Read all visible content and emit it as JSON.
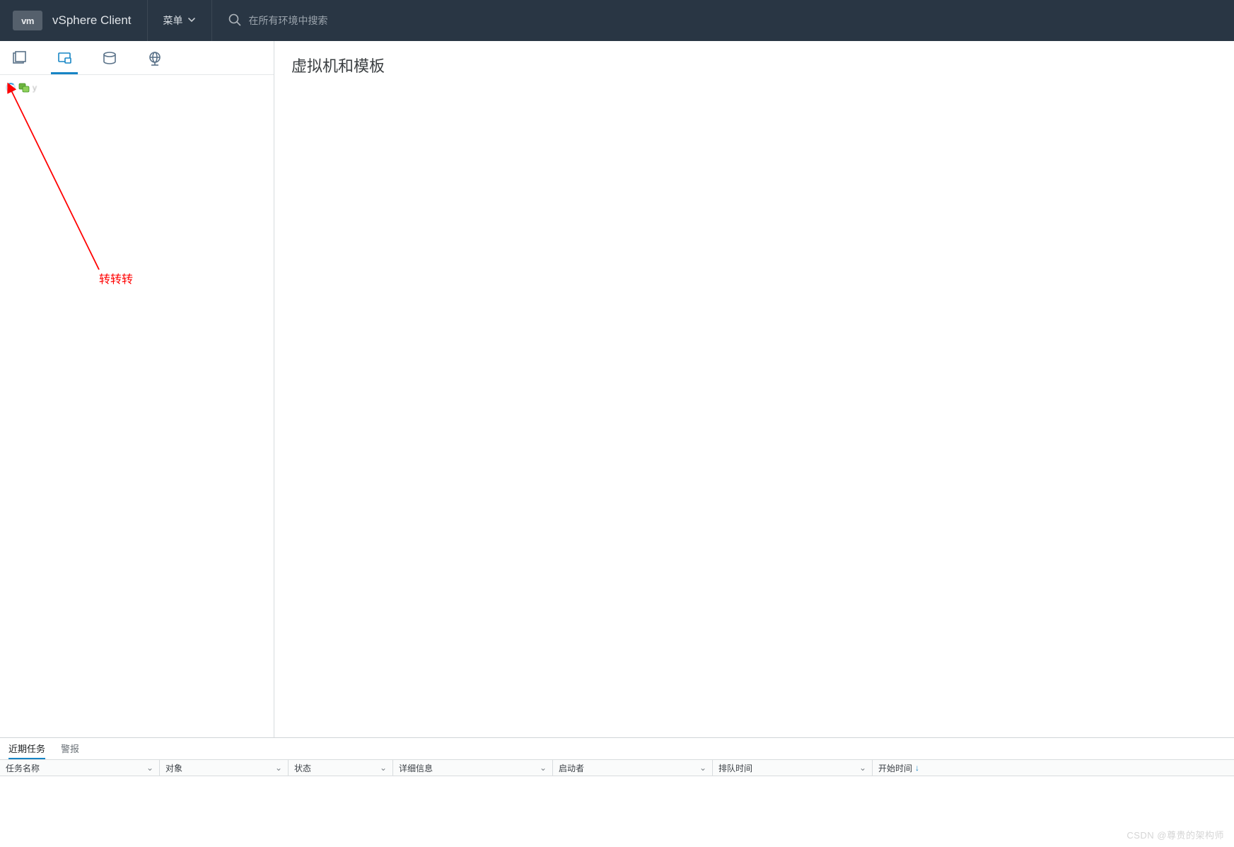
{
  "header": {
    "logo_text": "vm",
    "app_title": "vSphere Client",
    "menu_label": "菜单",
    "search_placeholder": "在所有环境中搜索"
  },
  "sidebar": {
    "tree_item_label": "y",
    "annotation_text": "转转转"
  },
  "main": {
    "title": "虚拟机和模板"
  },
  "bottom": {
    "tabs": {
      "recent": "近期任务",
      "alarms": "警报"
    },
    "columns": {
      "task_name": "任务名称",
      "target": "对象",
      "status": "状态",
      "details": "详细信息",
      "initiator": "启动者",
      "queued": "排队时间",
      "start": "开始时间"
    }
  },
  "watermark": "CSDN @尊贵的架构师"
}
